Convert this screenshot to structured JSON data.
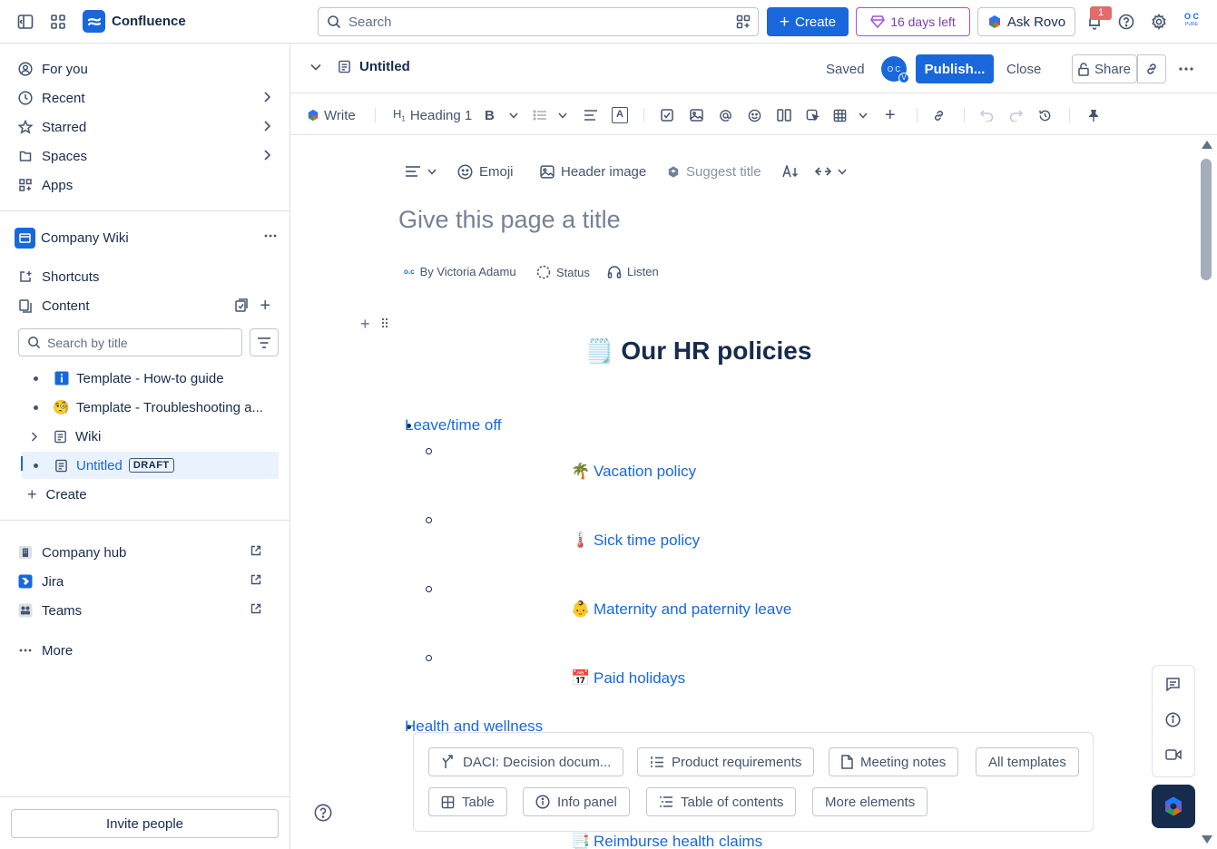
{
  "topbar": {
    "app_name": "Confluence",
    "search_placeholder": "Search",
    "create_label": "Create",
    "trial_label": "16 days left",
    "rovo_label": "Ask Rovo",
    "notification_count": "1",
    "avatar_initials": "O C",
    "avatar_sub": "PURE"
  },
  "sidebar": {
    "nav": [
      {
        "label": "For you",
        "icon": "person-circle-icon"
      },
      {
        "label": "Recent",
        "icon": "clock-icon"
      },
      {
        "label": "Starred",
        "icon": "star-icon"
      },
      {
        "label": "Spaces",
        "icon": "spaces-icon"
      },
      {
        "label": "Apps",
        "icon": "apps-icon"
      }
    ],
    "space_name": "Company Wiki",
    "shortcuts_label": "Shortcuts",
    "content_label": "Content",
    "filter_placeholder": "Search by title",
    "tree": [
      {
        "label": "Template - How-to guide",
        "icon": "info-icon"
      },
      {
        "label": "Template - Troubleshooting a...",
        "icon": "face-icon"
      },
      {
        "label": "Wiki",
        "icon": "page-icon"
      },
      {
        "label": "Untitled",
        "icon": "page-icon",
        "badge": "DRAFT"
      }
    ],
    "create_label": "Create",
    "links": [
      {
        "label": "Company hub",
        "icon": "building-icon"
      },
      {
        "label": "Jira",
        "icon": "jira-icon"
      },
      {
        "label": "Teams",
        "icon": "teams-icon"
      }
    ],
    "more_label": "More",
    "invite_label": "Invite people"
  },
  "page_header": {
    "title": "Untitled",
    "saved_label": "Saved",
    "user_initials": "O C",
    "user_sub": "V",
    "publish_label": "Publish...",
    "close_label": "Close",
    "share_label": "Share"
  },
  "toolbar": {
    "write_label": "Write",
    "heading_prefix": "H",
    "heading_sub": "1",
    "heading_label": "Heading 1",
    "bold_label": "B",
    "color_label": "A"
  },
  "editor": {
    "emoji_label": "Emoji",
    "header_image_label": "Header image",
    "suggest_title_label": "Suggest title",
    "title_placeholder": "Give this page a title",
    "byline_author": "By Victoria Adamu",
    "status_label": "Status",
    "listen_label": "Listen",
    "heading_emoji": "🗒️",
    "heading": "Our HR policies",
    "section1": "Leave/time off",
    "subitems": [
      {
        "emoji": "🌴",
        "label": "Vacation policy"
      },
      {
        "emoji": "🌡️",
        "label": "Sick time policy"
      },
      {
        "emoji": "👶",
        "label": "Maternity and paternity leave"
      },
      {
        "emoji": "📅",
        "label": "Paid holidays"
      }
    ],
    "section2": "Health and wellness",
    "partial_item": {
      "emoji": "📑",
      "label": "Reimburse health claims"
    }
  },
  "templates": {
    "row1": [
      "DACI: Decision docum...",
      "Product requirements",
      "Meeting notes",
      "All templates"
    ],
    "row2": [
      "Table",
      "Info panel",
      "Table of contents",
      "More elements"
    ]
  },
  "colors": {
    "brand": "#1868db",
    "trial": "#803fa5",
    "text": "#172b4d",
    "subtle": "#44546f",
    "selected_bg": "#e9f2ff"
  }
}
